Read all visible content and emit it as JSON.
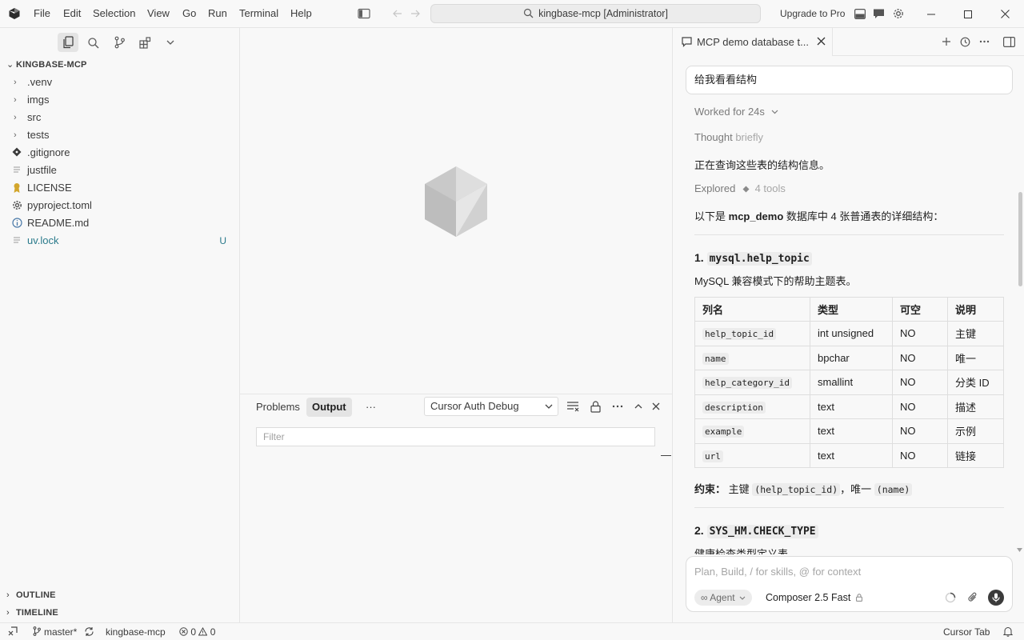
{
  "titlebar": {
    "menus": [
      "File",
      "Edit",
      "Selection",
      "View",
      "Go",
      "Run",
      "Terminal",
      "Help"
    ],
    "menu_mnemonics": [
      "F",
      "E",
      "S",
      "V",
      "G",
      "R",
      "T",
      "H"
    ],
    "search_text": "kingbase-mcp [Administrator]",
    "upgrade_label": "Upgrade to Pro"
  },
  "sidebar": {
    "root_label": "KINGBASE-MCP",
    "items": [
      {
        "label": ".venv",
        "type": "folder"
      },
      {
        "label": "imgs",
        "type": "folder"
      },
      {
        "label": "src",
        "type": "folder"
      },
      {
        "label": "tests",
        "type": "folder"
      },
      {
        "label": ".gitignore",
        "type": "git-file"
      },
      {
        "label": "justfile",
        "type": "text-file"
      },
      {
        "label": "LICENSE",
        "type": "license-file"
      },
      {
        "label": "pyproject.toml",
        "type": "config-file"
      },
      {
        "label": "README.md",
        "type": "info-file"
      },
      {
        "label": "uv.lock",
        "type": "text-file",
        "badge": "U"
      }
    ],
    "outline_label": "OUTLINE",
    "timeline_label": "TIMELINE"
  },
  "panel": {
    "tabs": [
      "Problems",
      "Output"
    ],
    "active_tab": "Output",
    "more": "···",
    "output_channel": "Cursor Auth Debug",
    "filter_placeholder": "Filter"
  },
  "chat": {
    "tab_title": "MCP demo database t...",
    "user_message": "给我看看结构",
    "worked_for": "Worked for 24s",
    "thought_label": "Thought",
    "thought_detail": "briefly",
    "line1": "正在查询这些表的结构信息。",
    "explored_label": "Explored",
    "explored_detail": "4 tools",
    "summary_pre": "以下是",
    "summary_db": "mcp_demo",
    "summary_post": "数据库中 4 张普通表的详细结构：",
    "section1": {
      "number": "1.",
      "name": "mysql.help_topic",
      "description": "MySQL 兼容模式下的帮助主题表。",
      "headers": [
        "列名",
        "类型",
        "可空",
        "说明"
      ],
      "rows": [
        [
          "help_topic_id",
          "int unsigned",
          "NO",
          "主键"
        ],
        [
          "name",
          "bpchar",
          "NO",
          "唯一"
        ],
        [
          "help_category_id",
          "smallint",
          "NO",
          "分类 ID"
        ],
        [
          "description",
          "text",
          "NO",
          "描述"
        ],
        [
          "example",
          "text",
          "NO",
          "示例"
        ],
        [
          "url",
          "text",
          "NO",
          "链接"
        ]
      ],
      "constraint_label": "约束：",
      "constraint_pk": "主键",
      "constraint_pk_code": "(help_topic_id)",
      "constraint_sep": "，唯一",
      "constraint_uq_code": "(name)"
    },
    "section2": {
      "number": "2.",
      "name": "SYS_HM.CHECK_TYPE",
      "description": "健康检查类型定义表。"
    },
    "composer_placeholder": "Plan, Build, / for skills, @ for context",
    "agent_label": "Agent",
    "model_label": "Composer 2.5 Fast"
  },
  "statusbar": {
    "branch": "master*",
    "project": "kingbase-mcp",
    "errors": "0",
    "warnings": "0",
    "cursor_tab": "Cursor Tab"
  }
}
